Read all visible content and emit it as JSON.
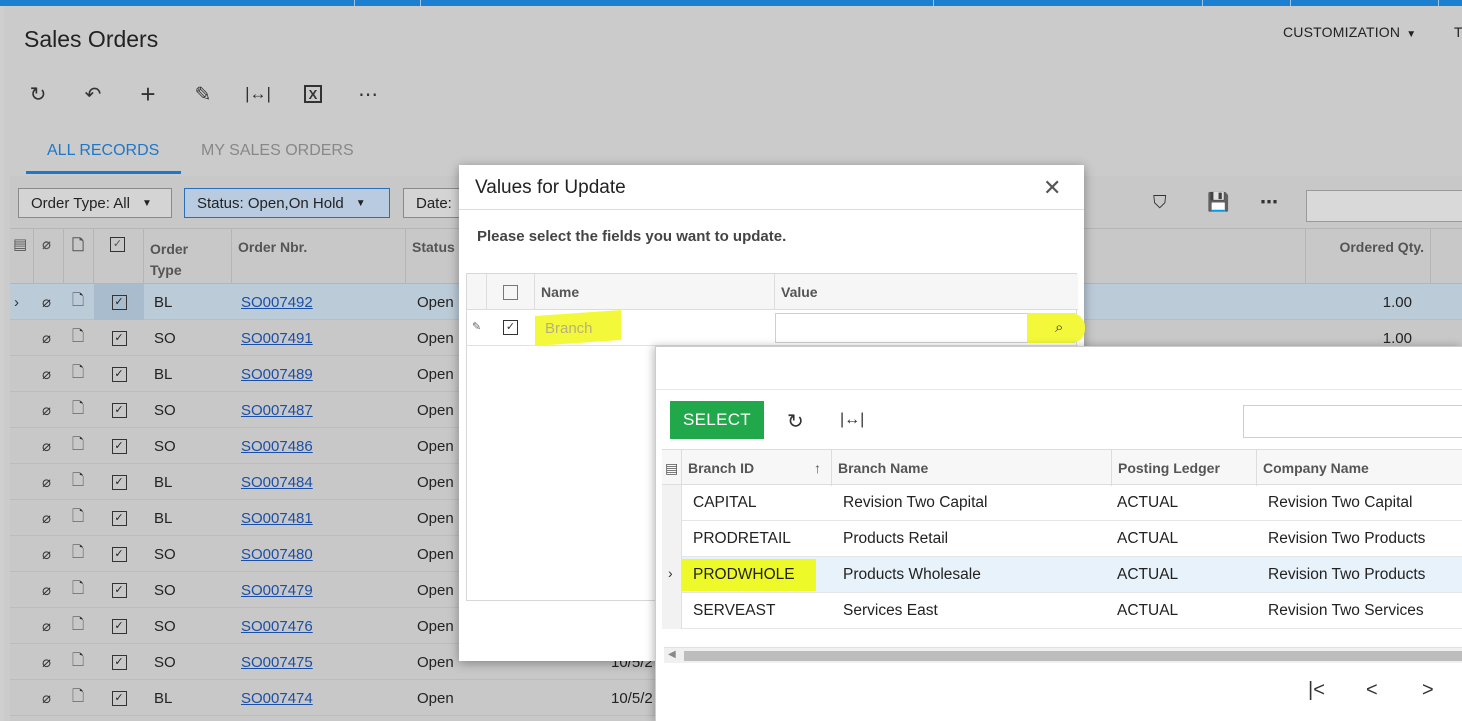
{
  "page": {
    "title": "Sales Orders",
    "customization_label": "CUSTOMIZATION",
    "cut_label": "T"
  },
  "toolbar_icons": [
    "refresh-icon",
    "undo-icon",
    "add-icon",
    "edit-icon",
    "fit-columns-icon",
    "excel-export-icon",
    "more-icon"
  ],
  "tabs": [
    {
      "label": "ALL RECORDS",
      "active": true
    },
    {
      "label": "MY SALES ORDERS",
      "active": false
    }
  ],
  "filters": {
    "order_type": "Order Type: All",
    "status": "Status: Open,On Hold",
    "date": "Date:"
  },
  "grid": {
    "headers": {
      "order_type": "Order Type",
      "order_type_line1": "Order",
      "order_type_line2": "Type",
      "order_nbr": "Order Nbr.",
      "status": "Status",
      "ordered_qty": "Ordered Qty."
    },
    "rows": [
      {
        "type": "BL",
        "nbr": "SO007492",
        "status": "Open",
        "date": "",
        "qty": "1.00",
        "selected": true
      },
      {
        "type": "SO",
        "nbr": "SO007491",
        "status": "Open",
        "date": "",
        "qty": "1.00"
      },
      {
        "type": "BL",
        "nbr": "SO007489",
        "status": "Open",
        "date": "",
        "qty": ""
      },
      {
        "type": "SO",
        "nbr": "SO007487",
        "status": "Open",
        "date": "",
        "qty": ""
      },
      {
        "type": "SO",
        "nbr": "SO007486",
        "status": "Open",
        "date": "",
        "qty": ""
      },
      {
        "type": "BL",
        "nbr": "SO007484",
        "status": "Open",
        "date": "",
        "qty": ""
      },
      {
        "type": "BL",
        "nbr": "SO007481",
        "status": "Open",
        "date": "",
        "qty": ""
      },
      {
        "type": "SO",
        "nbr": "SO007480",
        "status": "Open",
        "date": "",
        "qty": ""
      },
      {
        "type": "SO",
        "nbr": "SO007479",
        "status": "Open",
        "date": "",
        "qty": ""
      },
      {
        "type": "SO",
        "nbr": "SO007476",
        "status": "Open",
        "date": "",
        "qty": ""
      },
      {
        "type": "SO",
        "nbr": "SO007475",
        "status": "Open",
        "date": "10/5/2",
        "qty": ""
      },
      {
        "type": "BL",
        "nbr": "SO007474",
        "status": "Open",
        "date": "10/5/2",
        "qty": ""
      }
    ]
  },
  "dialog": {
    "title": "Values for Update",
    "prompt": "Please select the fields you want to update.",
    "col_name": "Name",
    "col_value": "Value",
    "row_name": "Branch",
    "row_value": ""
  },
  "lookup": {
    "select_label": "SELECT",
    "search_value": "",
    "headers": {
      "branch_id": "Branch ID",
      "branch_name": "Branch Name",
      "posting_ledger": "Posting Ledger",
      "company_name": "Company Name"
    },
    "sort_indicator": "↑",
    "rows": [
      {
        "id": "CAPITAL",
        "name": "Revision Two Capital",
        "ledger": "ACTUAL",
        "company": "Revision Two Capital"
      },
      {
        "id": "PRODRETAIL",
        "name": "Products Retail",
        "ledger": "ACTUAL",
        "company": "Revision Two Products"
      },
      {
        "id": "PRODWHOLE",
        "name": "Products Wholesale",
        "ledger": "ACTUAL",
        "company": "Revision Two Products",
        "selected": true
      },
      {
        "id": "SERVEAST",
        "name": "Services East",
        "ledger": "ACTUAL",
        "company": "Revision Two Services"
      }
    ]
  },
  "colors": {
    "accent": "#1f77c8",
    "select_button": "#21a84a",
    "highlight": "#f3f93a",
    "link": "#1b4fa7"
  }
}
